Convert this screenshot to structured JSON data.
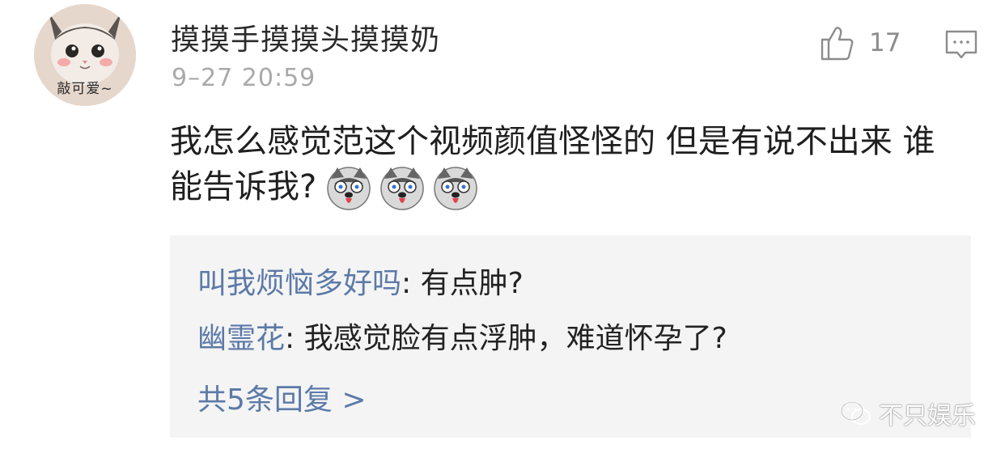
{
  "comment": {
    "username": "摸摸手摸摸头摸摸奶",
    "timestamp": "9–27 20:59",
    "avatar_caption": "敲可爱~",
    "text": "我怎么感觉范这个视频颜值怪怪的 但是有说不出来 谁能告诉我?",
    "like_count": "17",
    "emojis": [
      "husky-emoji",
      "husky-emoji",
      "husky-emoji"
    ]
  },
  "replies": [
    {
      "author": "叫我烦恼多好吗",
      "separator": ": ",
      "text": "有点肿?"
    },
    {
      "author": "幽霊花",
      "separator": ": ",
      "text": "我感觉脸有点浮肿，难道怀孕了?"
    }
  ],
  "more_replies": "共5条回复 >",
  "watermark": "不只娱乐",
  "colors": {
    "link_blue": "#5c7aa8",
    "timestamp_gray": "#a9a9a9",
    "reply_bg": "#f4f4f4"
  }
}
